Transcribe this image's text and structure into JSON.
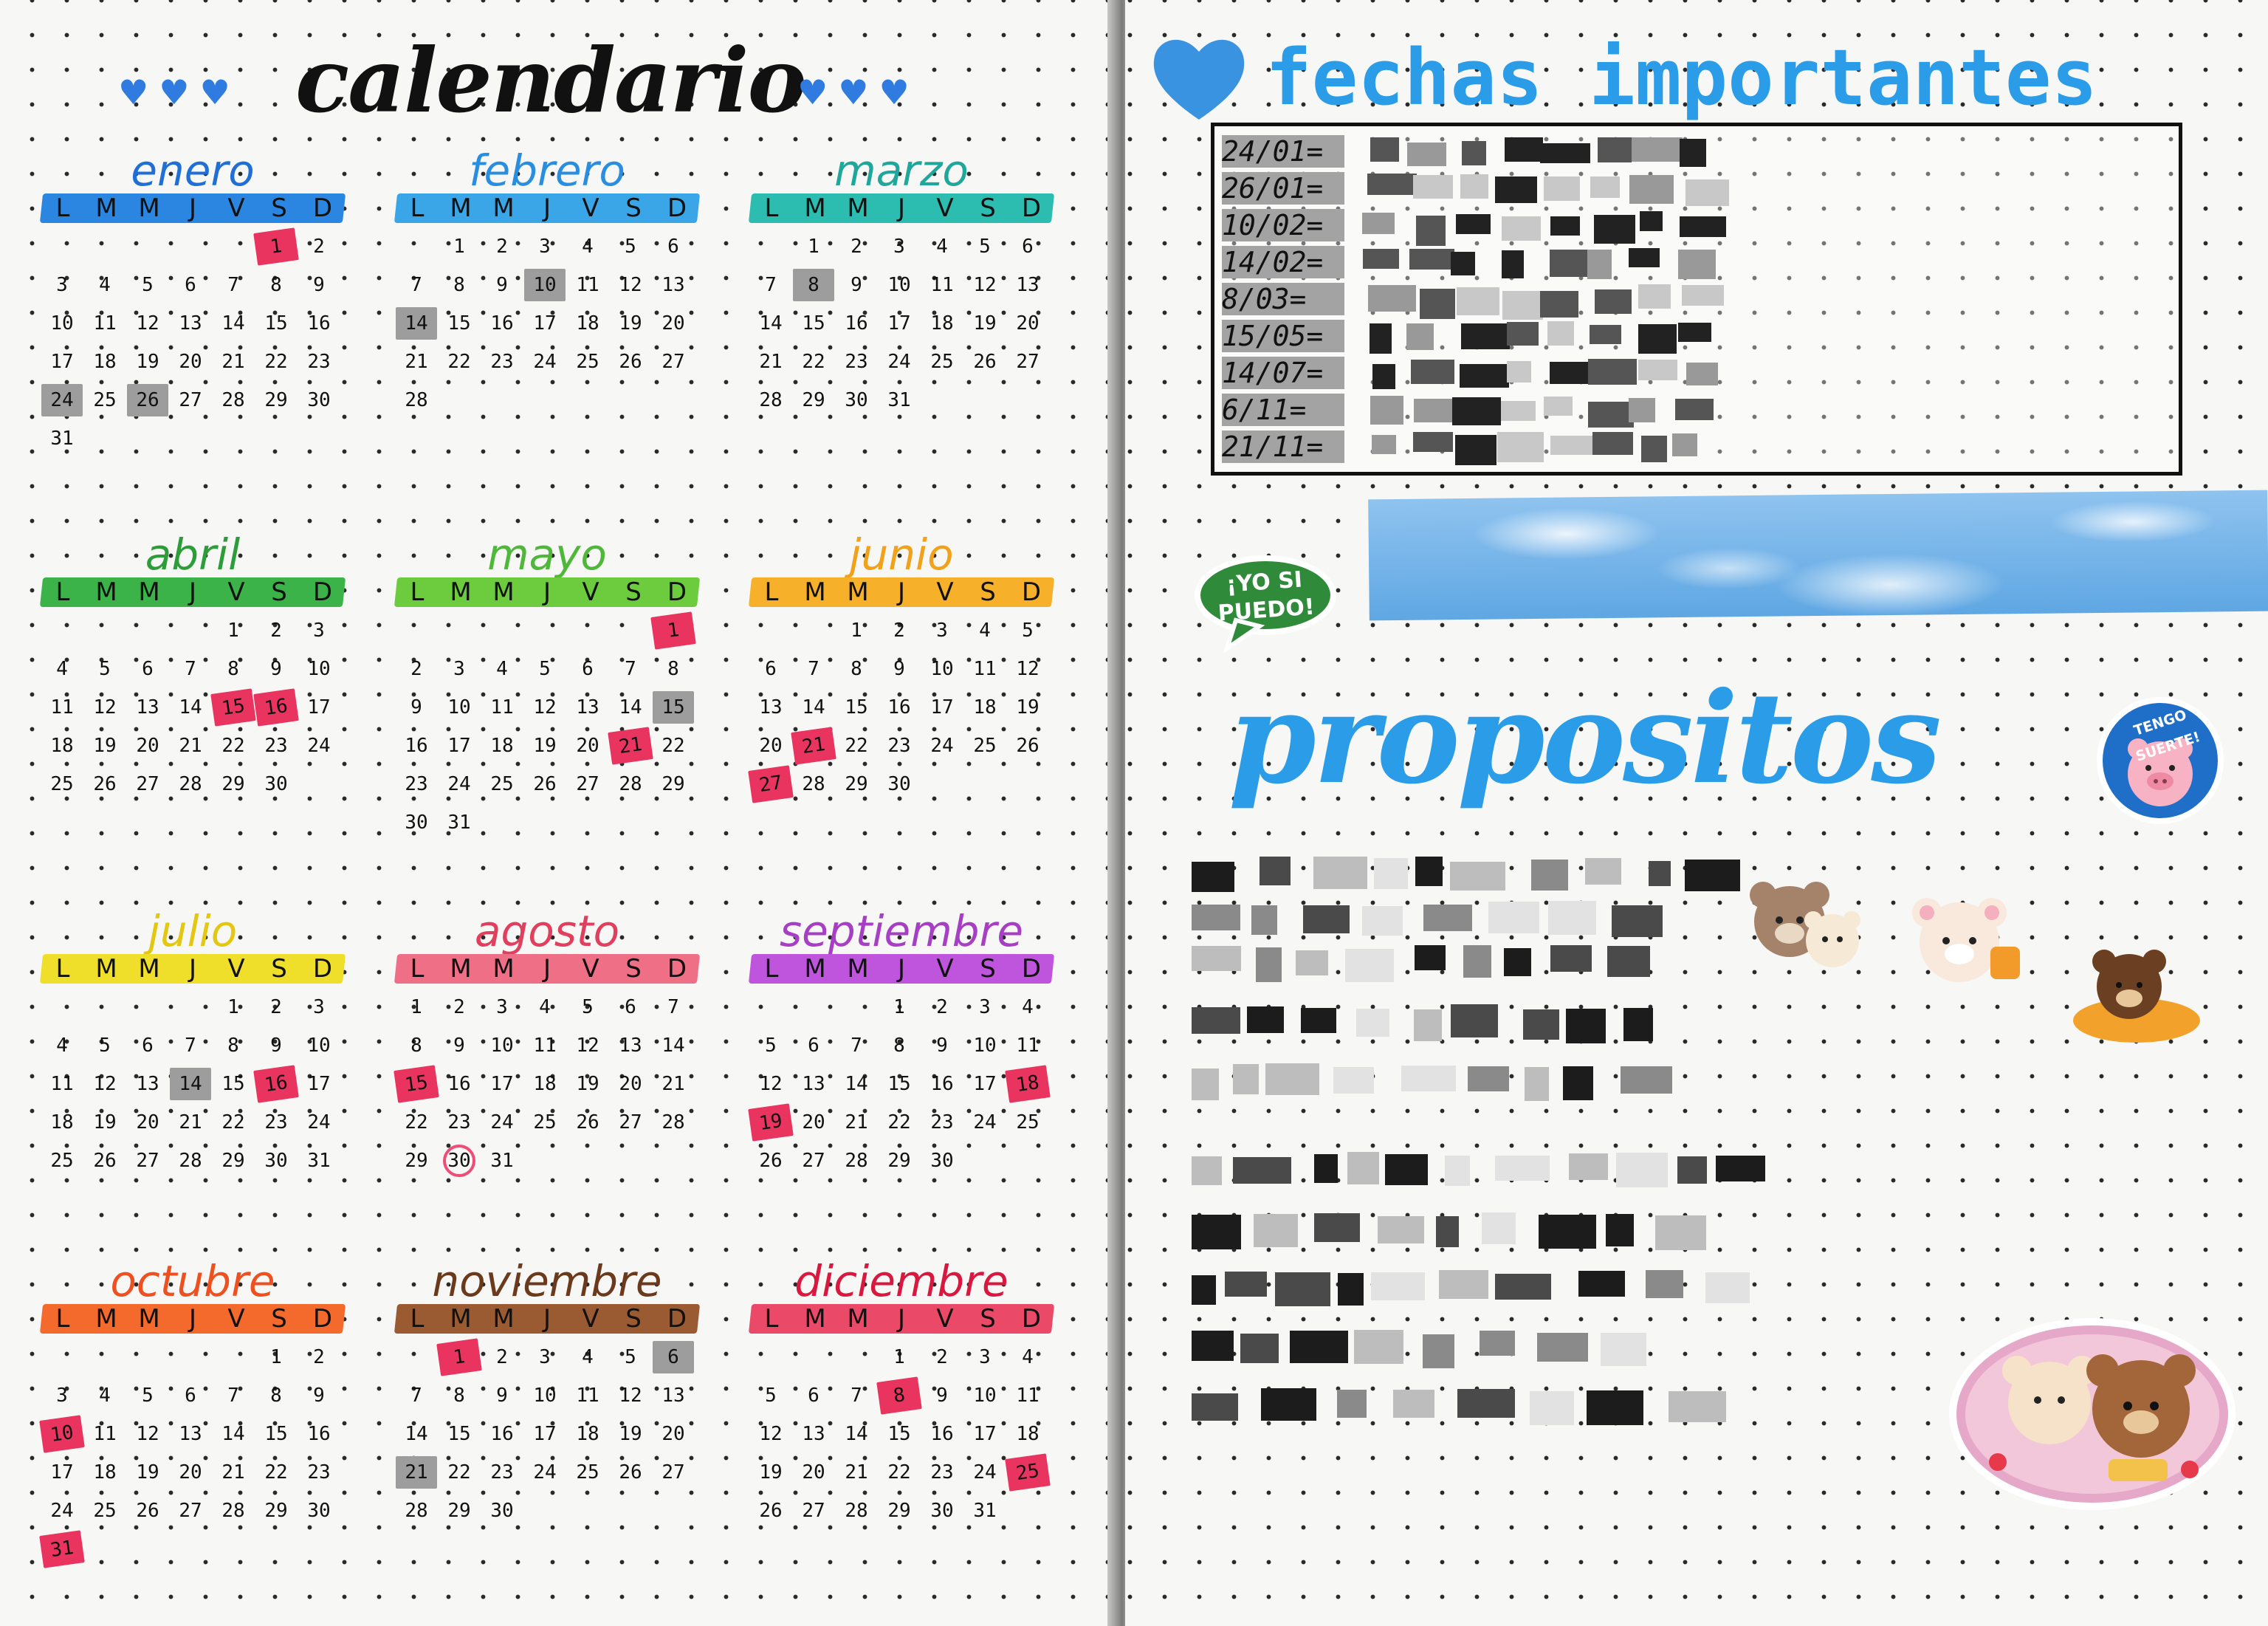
{
  "left_page": {
    "title": "calendario",
    "hearts": "♥♥♥",
    "week_letters": [
      "L",
      "M",
      "M",
      "J",
      "V",
      "S",
      "D"
    ],
    "months": [
      {
        "name": "enero",
        "color": "#1f6fd6",
        "bar": "#2a86e0",
        "offset": 5,
        "days": 31,
        "red": [
          1
        ],
        "grey": [
          24,
          26
        ],
        "circle": []
      },
      {
        "name": "febrero",
        "color": "#2a8ee0",
        "bar": "#3aa6e8",
        "offset": 1,
        "days": 28,
        "red": [],
        "grey": [
          10,
          14
        ],
        "circle": []
      },
      {
        "name": "marzo",
        "color": "#1ea79a",
        "bar": "#2cbcb0",
        "offset": 1,
        "days": 31,
        "red": [],
        "grey": [
          8
        ],
        "circle": []
      },
      {
        "name": "abril",
        "color": "#2d9d3a",
        "bar": "#3bb348",
        "offset": 4,
        "days": 30,
        "red": [
          15,
          16
        ],
        "grey": [],
        "circle": []
      },
      {
        "name": "mayo",
        "color": "#4fb83a",
        "bar": "#6ccc3e",
        "offset": 6,
        "days": 31,
        "red": [
          1,
          21
        ],
        "grey": [
          15
        ],
        "circle": []
      },
      {
        "name": "junio",
        "color": "#f2a21a",
        "bar": "#f7b02a",
        "offset": 2,
        "days": 30,
        "red": [
          21,
          27
        ],
        "grey": [],
        "circle": []
      },
      {
        "name": "julio",
        "color": "#e3c710",
        "bar": "#efdf2a",
        "offset": 4,
        "days": 31,
        "red": [
          16
        ],
        "grey": [
          14
        ],
        "circle": []
      },
      {
        "name": "agosto",
        "color": "#e0405e",
        "bar": "#ee6f86",
        "offset": 0,
        "days": 31,
        "red": [
          15
        ],
        "grey": [],
        "circle": [
          30
        ]
      },
      {
        "name": "septiembre",
        "color": "#a63fc4",
        "bar": "#bf55dc",
        "offset": 3,
        "days": 30,
        "red": [
          18,
          19
        ],
        "grey": [],
        "circle": []
      },
      {
        "name": "octubre",
        "color": "#ee5020",
        "bar": "#f46a2c",
        "offset": 5,
        "days": 31,
        "red": [
          10,
          31
        ],
        "grey": [],
        "circle": []
      },
      {
        "name": "noviembre",
        "color": "#6b3a1c",
        "bar": "#9a5a32",
        "offset": 1,
        "days": 30,
        "red": [
          1
        ],
        "grey": [
          6,
          21
        ],
        "circle": []
      },
      {
        "name": "diciembre",
        "color": "#d9183f",
        "bar": "#ea4a68",
        "offset": 3,
        "days": 31,
        "red": [
          8,
          25
        ],
        "grey": [],
        "circle": []
      }
    ]
  },
  "right_page": {
    "title": "fechas importantes",
    "dates": [
      "24/01=",
      "26/01=",
      "10/02=",
      "14/02=",
      "8/03=",
      "15/05=",
      "14/07=",
      "6/11=",
      "21/11="
    ],
    "sticker_yosi": "¡YO SI PUEDO!",
    "propositos": "propositos",
    "sticker_suerte": "TENGO SUERTE!"
  },
  "colors": {
    "accent_blue": "#2b9de8",
    "red_highlight": "#e8345e",
    "grey_highlight": "#9d9d9d"
  }
}
